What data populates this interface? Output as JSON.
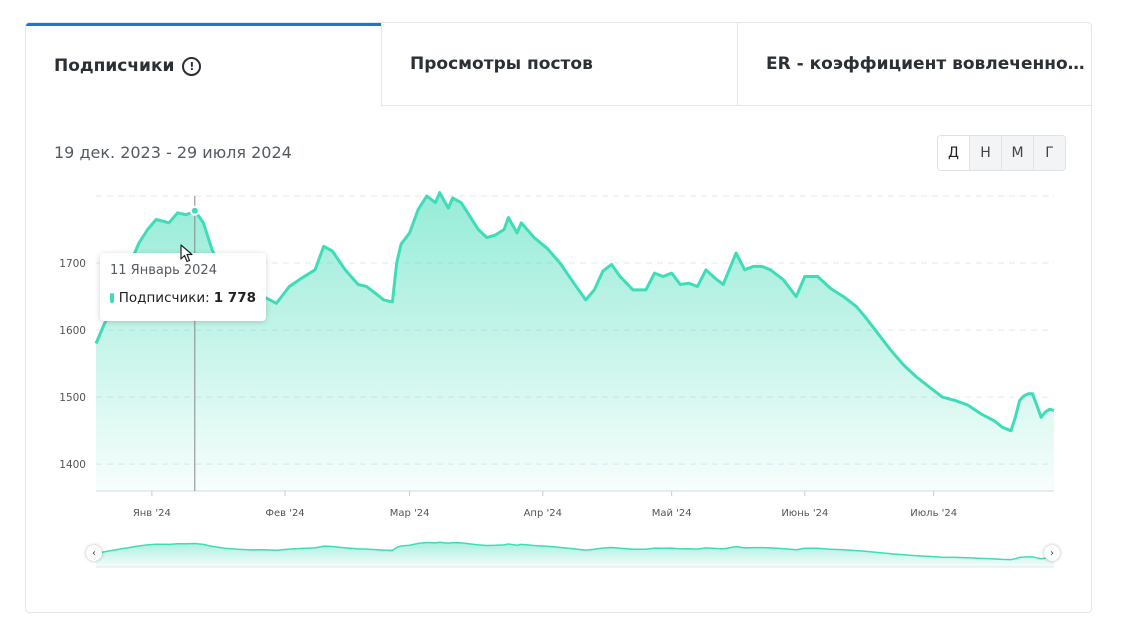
{
  "tabs": [
    {
      "label": "Подписчики",
      "icon": "info-circle-icon",
      "active": true
    },
    {
      "label": "Просмотры постов",
      "active": false
    },
    {
      "label": "ER - коэффициент вовлеченнос...",
      "active": false
    }
  ],
  "date_range": "19 дек. 2023 - 29 июля 2024",
  "period_buttons": [
    "Д",
    "Н",
    "М",
    "Г"
  ],
  "period_selected": "Д",
  "tooltip": {
    "date": "11 Январь 2024",
    "series_label": "Подписчики:",
    "value": "1 778"
  },
  "colors": {
    "accent_tab": "#1677d9",
    "series": "#3fdcb8"
  },
  "chart_data": {
    "type": "area",
    "y_ticks": [
      "1400",
      "1500",
      "1600",
      "1700"
    ],
    "x_ticks": [
      "Янв '24",
      "Фев '24",
      "Мар '24",
      "Апр '24",
      "Май '24",
      "Июнь '24",
      "Июль '24"
    ],
    "ylim": [
      1360,
      1800
    ],
    "xlim": [
      "2023-12-19",
      "2024-07-29"
    ],
    "grid": true,
    "points": [
      [
        "2023-12-19",
        1580
      ],
      [
        "2023-12-21",
        1610
      ],
      [
        "2023-12-23",
        1640
      ],
      [
        "2023-12-25",
        1670
      ],
      [
        "2023-12-27",
        1700
      ],
      [
        "2023-12-29",
        1730
      ],
      [
        "2023-12-31",
        1750
      ],
      [
        "2024-01-02",
        1765
      ],
      [
        "2024-01-05",
        1760
      ],
      [
        "2024-01-07",
        1775
      ],
      [
        "2024-01-09",
        1772
      ],
      [
        "2024-01-11",
        1778
      ],
      [
        "2024-01-13",
        1760
      ],
      [
        "2024-01-15",
        1720
      ],
      [
        "2024-01-18",
        1680
      ],
      [
        "2024-01-21",
        1660
      ],
      [
        "2024-01-24",
        1648
      ],
      [
        "2024-01-27",
        1650
      ],
      [
        "2024-01-30",
        1640
      ],
      [
        "2024-02-02",
        1665
      ],
      [
        "2024-02-05",
        1678
      ],
      [
        "2024-02-08",
        1690
      ],
      [
        "2024-02-10",
        1725
      ],
      [
        "2024-02-12",
        1718
      ],
      [
        "2024-02-15",
        1690
      ],
      [
        "2024-02-18",
        1668
      ],
      [
        "2024-02-20",
        1665
      ],
      [
        "2024-02-22",
        1655
      ],
      [
        "2024-02-24",
        1645
      ],
      [
        "2024-02-26",
        1642
      ],
      [
        "2024-02-27",
        1700
      ],
      [
        "2024-02-28",
        1728
      ],
      [
        "2024-03-01",
        1745
      ],
      [
        "2024-03-03",
        1780
      ],
      [
        "2024-03-05",
        1800
      ],
      [
        "2024-03-07",
        1790
      ],
      [
        "2024-03-08",
        1805
      ],
      [
        "2024-03-10",
        1782
      ],
      [
        "2024-03-11",
        1797
      ],
      [
        "2024-03-13",
        1790
      ],
      [
        "2024-03-15",
        1770
      ],
      [
        "2024-03-17",
        1750
      ],
      [
        "2024-03-19",
        1738
      ],
      [
        "2024-03-21",
        1742
      ],
      [
        "2024-03-23",
        1750
      ],
      [
        "2024-03-24",
        1768
      ],
      [
        "2024-03-26",
        1745
      ],
      [
        "2024-03-27",
        1760
      ],
      [
        "2024-03-30",
        1738
      ],
      [
        "2024-04-02",
        1722
      ],
      [
        "2024-04-05",
        1700
      ],
      [
        "2024-04-08",
        1672
      ],
      [
        "2024-04-11",
        1645
      ],
      [
        "2024-04-13",
        1660
      ],
      [
        "2024-04-15",
        1688
      ],
      [
        "2024-04-17",
        1698
      ],
      [
        "2024-04-19",
        1680
      ],
      [
        "2024-04-22",
        1660
      ],
      [
        "2024-04-25",
        1660
      ],
      [
        "2024-04-27",
        1685
      ],
      [
        "2024-04-29",
        1680
      ],
      [
        "2024-05-01",
        1685
      ],
      [
        "2024-05-03",
        1668
      ],
      [
        "2024-05-05",
        1670
      ],
      [
        "2024-05-07",
        1665
      ],
      [
        "2024-05-09",
        1690
      ],
      [
        "2024-05-11",
        1678
      ],
      [
        "2024-05-13",
        1668
      ],
      [
        "2024-05-16",
        1715
      ],
      [
        "2024-05-18",
        1690
      ],
      [
        "2024-05-20",
        1695
      ],
      [
        "2024-05-22",
        1695
      ],
      [
        "2024-05-24",
        1690
      ],
      [
        "2024-05-27",
        1675
      ],
      [
        "2024-05-30",
        1650
      ],
      [
        "2024-06-01",
        1680
      ],
      [
        "2024-06-04",
        1680
      ],
      [
        "2024-06-07",
        1662
      ],
      [
        "2024-06-10",
        1650
      ],
      [
        "2024-06-13",
        1635
      ],
      [
        "2024-06-15",
        1620
      ],
      [
        "2024-06-18",
        1595
      ],
      [
        "2024-06-21",
        1570
      ],
      [
        "2024-06-24",
        1548
      ],
      [
        "2024-06-27",
        1530
      ],
      [
        "2024-06-30",
        1515
      ],
      [
        "2024-07-03",
        1500
      ],
      [
        "2024-07-06",
        1495
      ],
      [
        "2024-07-09",
        1488
      ],
      [
        "2024-07-12",
        1475
      ],
      [
        "2024-07-15",
        1465
      ],
      [
        "2024-07-17",
        1455
      ],
      [
        "2024-07-19",
        1450
      ],
      [
        "2024-07-20",
        1470
      ],
      [
        "2024-07-21",
        1495
      ],
      [
        "2024-07-22",
        1502
      ],
      [
        "2024-07-23",
        1505
      ],
      [
        "2024-07-24",
        1505
      ],
      [
        "2024-07-25",
        1488
      ],
      [
        "2024-07-26",
        1470
      ],
      [
        "2024-07-27",
        1478
      ],
      [
        "2024-07-28",
        1482
      ],
      [
        "2024-07-29",
        1480
      ]
    ]
  }
}
